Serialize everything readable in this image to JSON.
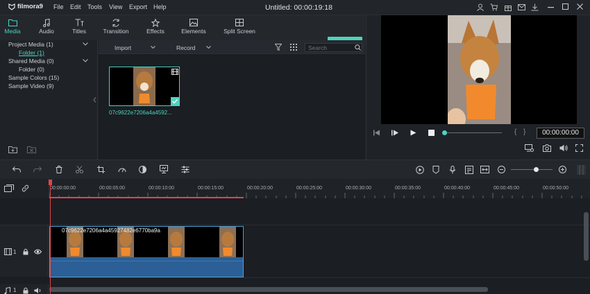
{
  "app": {
    "name": "filmora9",
    "title": "Untitled:  00:00:19:18"
  },
  "menu": [
    "File",
    "Edit",
    "Tools",
    "View",
    "Export",
    "Help"
  ],
  "tabs": [
    {
      "label": "Media",
      "icon": "folder-icon",
      "active": true
    },
    {
      "label": "Audio",
      "icon": "music-note-icon"
    },
    {
      "label": "Titles",
      "icon": "text-icon"
    },
    {
      "label": "Transition",
      "icon": "transition-icon"
    },
    {
      "label": "Effects",
      "icon": "effects-icon"
    },
    {
      "label": "Elements",
      "icon": "image-icon"
    },
    {
      "label": "Split Screen",
      "icon": "split-screen-icon"
    }
  ],
  "export_label": "EXPORT",
  "sidebar": {
    "items": [
      {
        "label": "Project Media (1)",
        "expandable": true
      },
      {
        "label": "Folder (1)",
        "selected": true
      },
      {
        "label": "Shared Media (0)",
        "expandable": true
      },
      {
        "label": "Folder (0)"
      },
      {
        "label": "Sample Colors (15)"
      },
      {
        "label": "Sample Video (9)"
      }
    ]
  },
  "media_toolbar": {
    "import_label": "Import",
    "record_label": "Record",
    "search_placeholder": "Search"
  },
  "media_item": {
    "name": "07c9622e7206a4a4592..."
  },
  "preview": {
    "timecode": "00:00:00:00",
    "brace_open": "{",
    "brace_close": "}",
    "progress": 0
  },
  "ruler": [
    "00:00:00:00",
    "00:00:05:00",
    "00:00:10:00",
    "00:00:15:00",
    "00:00:20:00",
    "00:00:25:00",
    "00:00:30:00",
    "00:00:35:00",
    "00:00:40:00",
    "00:00:45:00",
    "00:00:50:00"
  ],
  "tracks": {
    "video_track_number": "1",
    "audio_track_number": "1",
    "clip_name": "07c9622e7206a4a45927482e6770ba9a"
  },
  "colors": {
    "accent": "#4ed3c0",
    "playhead": "#e0454a",
    "audio": "#2b5f95"
  }
}
